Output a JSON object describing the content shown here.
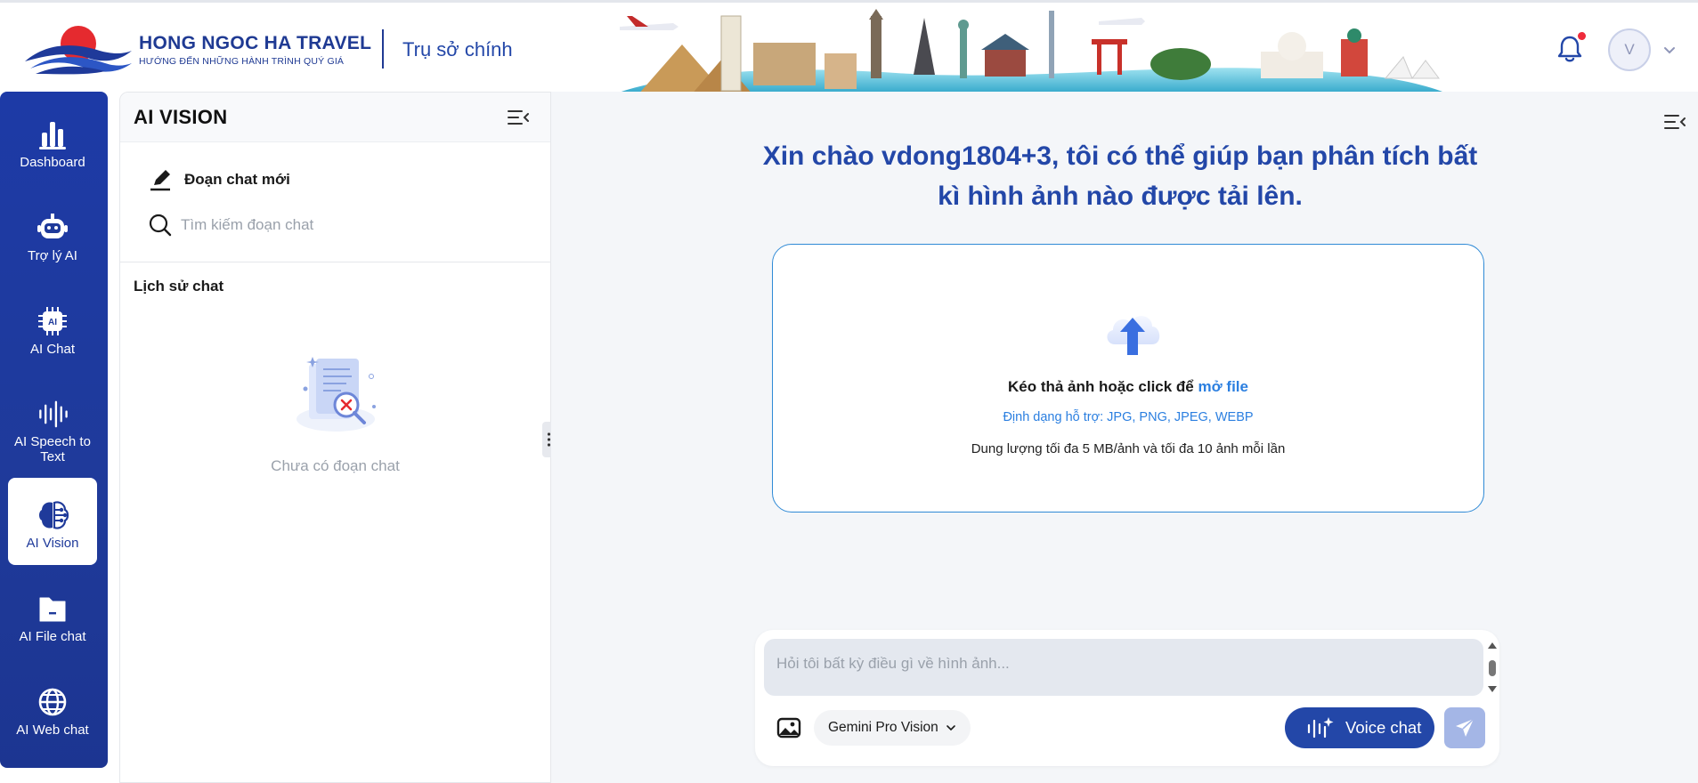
{
  "header": {
    "brand_name": "HONG NGOC HA TRAVEL",
    "slogan": "HƯỚNG ĐẾN NHỮNG HÀNH TRÌNH QUÝ GIÁ",
    "office": "Trụ sở chính",
    "avatar_initial": "V",
    "has_notification": true
  },
  "nav": {
    "items": [
      {
        "label": "Dashboard",
        "icon": "bar-chart-icon"
      },
      {
        "label": "Trợ lý AI",
        "icon": "robot-icon"
      },
      {
        "label": "AI Chat",
        "icon": "ai-chip-icon"
      },
      {
        "label": "AI Speech to Text",
        "icon": "soundwave-icon"
      },
      {
        "label": "AI Vision",
        "icon": "brain-icon",
        "active": true
      },
      {
        "label": "AI File chat",
        "icon": "folder-icon"
      },
      {
        "label": "AI Web chat",
        "icon": "globe-icon"
      }
    ]
  },
  "panel": {
    "title": "AI VISION",
    "new_chat": "Đoạn chat mới",
    "search_placeholder": "Tìm kiếm đoạn chat",
    "history_title": "Lịch sử chat",
    "empty_text": "Chưa có đoạn chat"
  },
  "main": {
    "greeting": "Xin chào vdong1804+3, tôi có thể giúp bạn phân tích bất kì hình ảnh nào được tải lên.",
    "drop_text": "Kéo thả ảnh hoặc click để ",
    "drop_link": "mở file",
    "formats": "Định dạng hỗ trợ: JPG, PNG, JPEG, WEBP",
    "size_limit": "Dung lượng tối đa 5 MB/ảnh và tối đa 10 ảnh mỗi lần",
    "prompt_placeholder": "Hỏi tôi bất kỳ điều gì về hình ảnh...",
    "model": "Gemini Pro Vision",
    "voice_label": "Voice chat"
  },
  "colors": {
    "brand_blue": "#1f3a9a",
    "accent_link": "#2b7fe0",
    "notification_red": "#ef2b3b",
    "send_disabled": "#a4b6e6"
  }
}
